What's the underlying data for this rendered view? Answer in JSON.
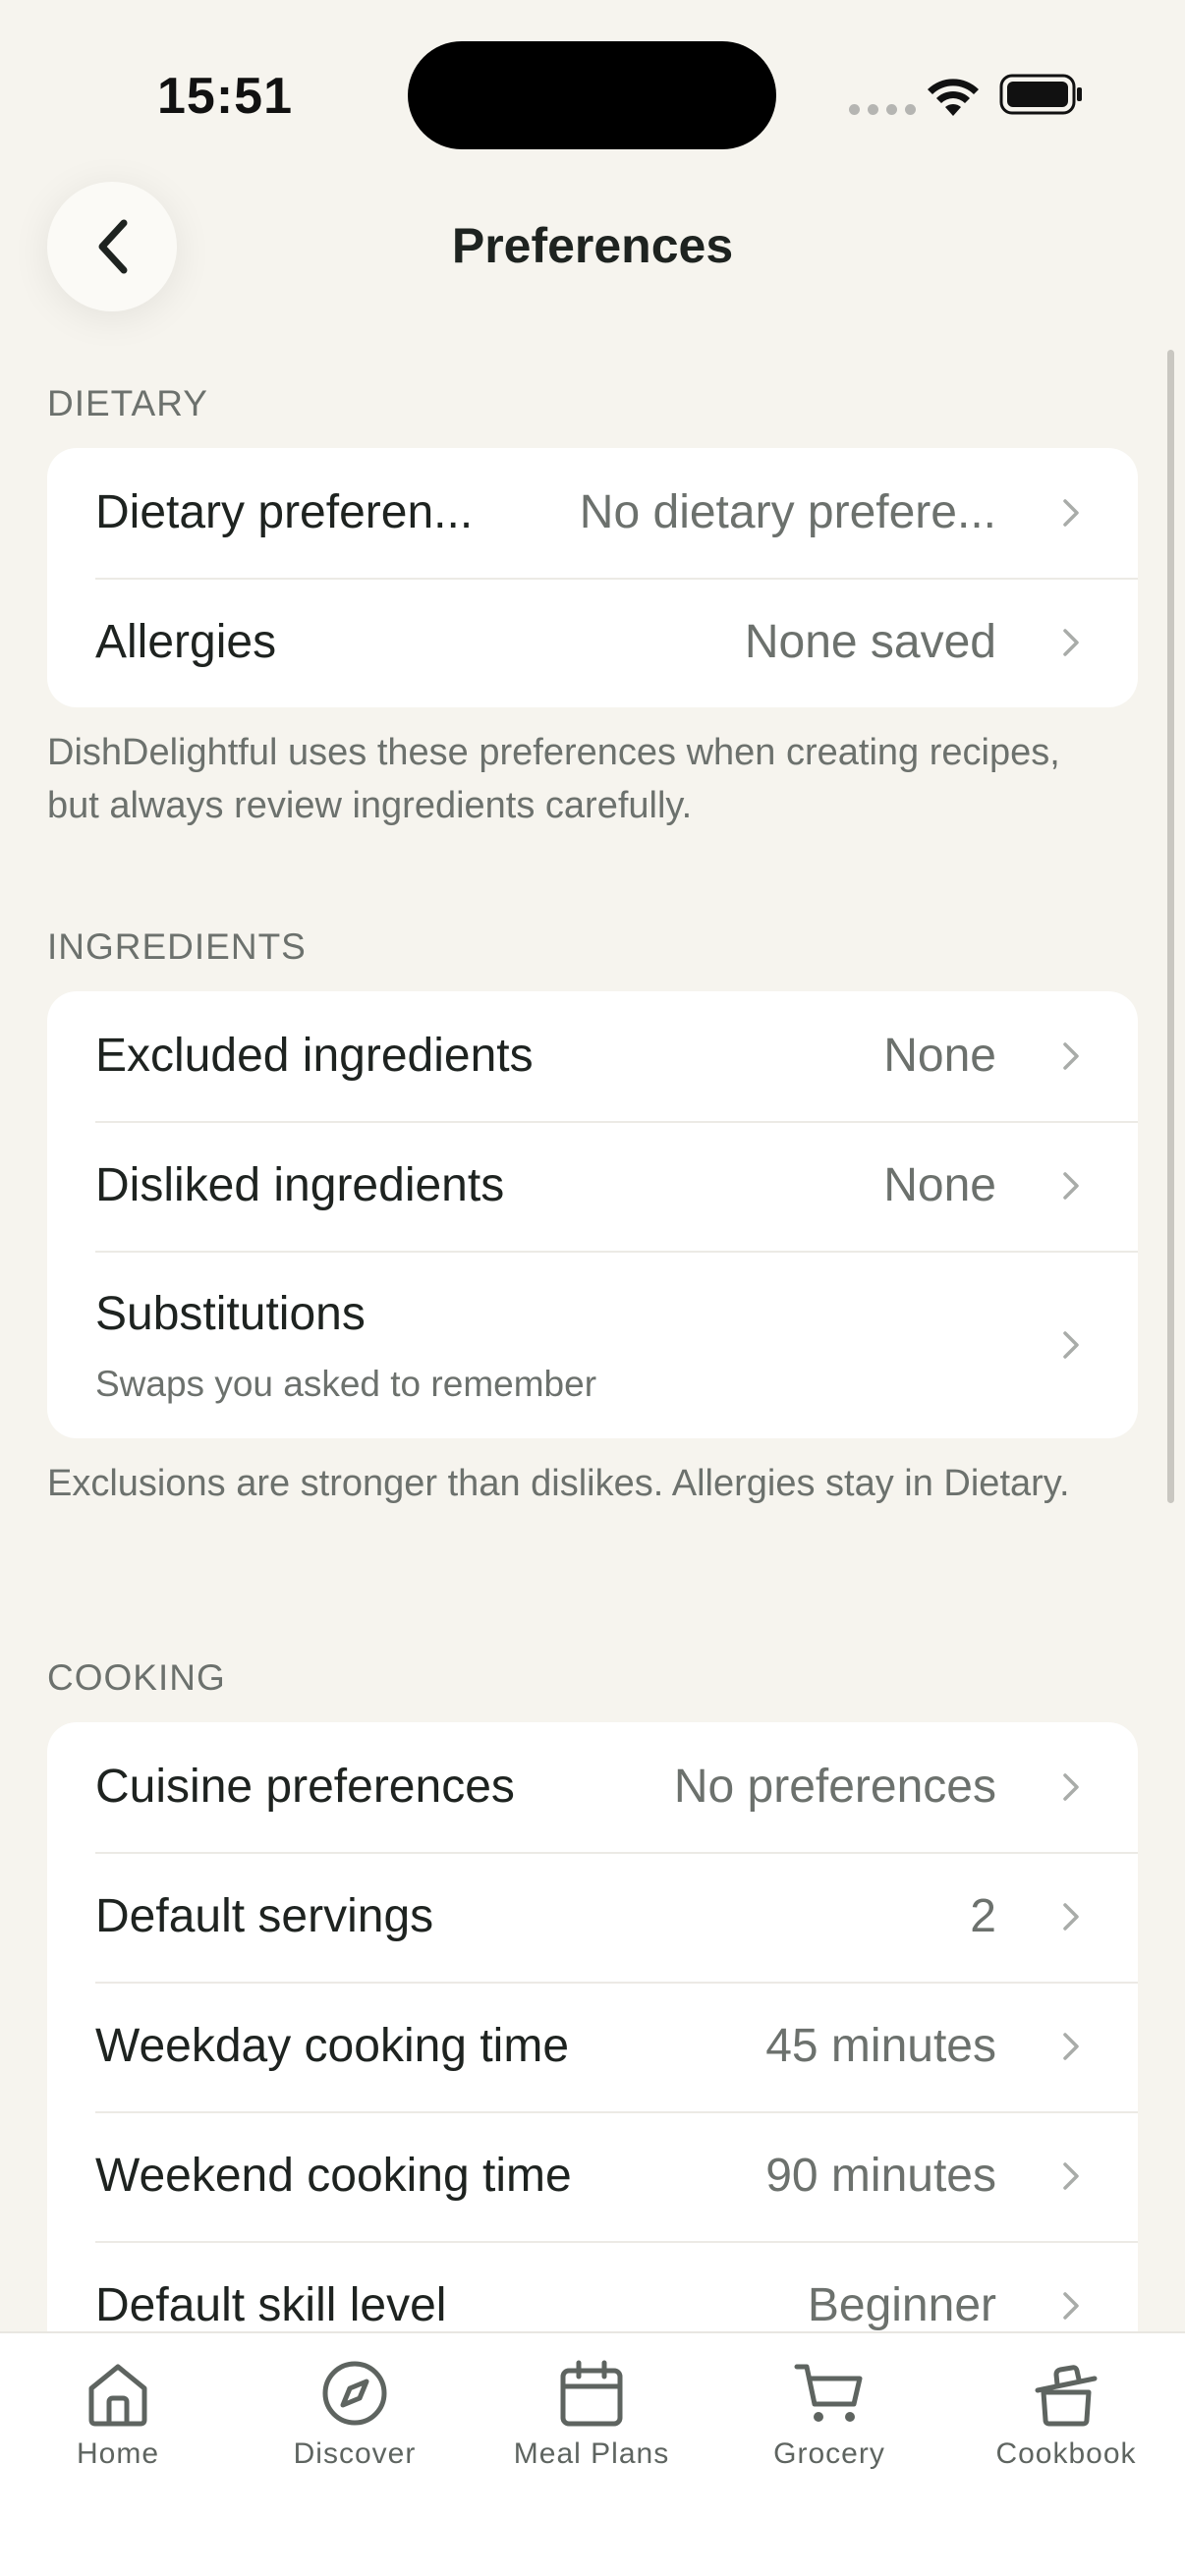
{
  "status_bar": {
    "time": "15:51"
  },
  "nav": {
    "title": "Preferences"
  },
  "sections": {
    "dietary": {
      "header": "DIETARY",
      "rows": [
        {
          "label": "Dietary preferen...",
          "value": "No dietary prefere..."
        },
        {
          "label": "Allergies",
          "value": "None saved"
        }
      ],
      "footnote": "DishDelightful uses these preferences when creating recipes, but always review ingredients carefully."
    },
    "ingredients": {
      "header": "INGREDIENTS",
      "rows": [
        {
          "label": "Excluded ingredients",
          "value": "None"
        },
        {
          "label": "Disliked ingredients",
          "value": "None"
        },
        {
          "label": "Substitutions",
          "subtitle": "Swaps you asked to remember"
        }
      ],
      "footnote": "Exclusions are stronger than dislikes. Allergies stay in Dietary."
    },
    "cooking": {
      "header": "COOKING",
      "rows": [
        {
          "label": "Cuisine preferences",
          "value": "No preferences"
        },
        {
          "label": "Default servings",
          "value": "2"
        },
        {
          "label": "Weekday cooking time",
          "value": "45 minutes"
        },
        {
          "label": "Weekend cooking time",
          "value": "90 minutes"
        },
        {
          "label": "Default skill level",
          "value": "Beginner"
        }
      ]
    }
  },
  "tab_bar": {
    "tabs": [
      {
        "label": "Home",
        "icon": "house-icon"
      },
      {
        "label": "Discover",
        "icon": "compass-icon"
      },
      {
        "label": "Meal Plans",
        "icon": "calendar-icon"
      },
      {
        "label": "Grocery",
        "icon": "cart-icon"
      },
      {
        "label": "Cookbook",
        "icon": "pot-icon"
      }
    ]
  },
  "colors": {
    "background": "#F6F4EE",
    "card": "#FFFFFF",
    "primary_text": "#1E2320",
    "secondary_text": "#6C716D"
  }
}
